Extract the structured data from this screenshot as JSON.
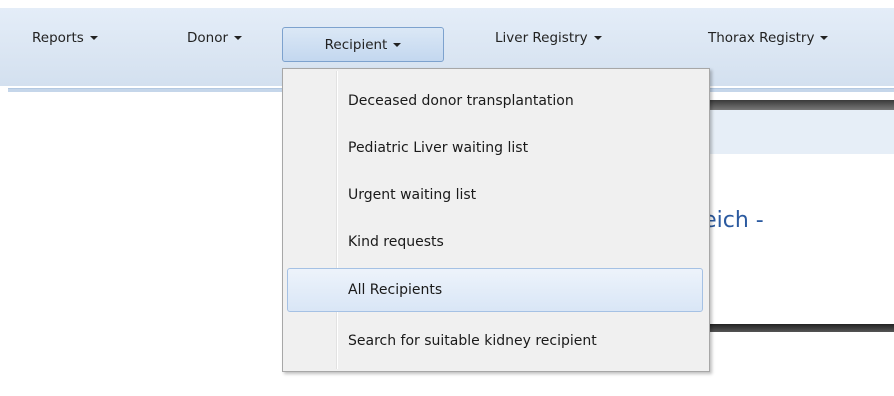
{
  "navbar": {
    "items": [
      {
        "label": "Reports"
      },
      {
        "label": "Donor"
      },
      {
        "label": "Recipient"
      },
      {
        "label": "Liver Registry"
      },
      {
        "label": "Thorax Registry"
      }
    ],
    "active_item": "Recipient"
  },
  "recipient_menu": {
    "items": [
      {
        "label": "Deceased donor transplantation"
      },
      {
        "label": "Pediatric Liver waiting list"
      },
      {
        "label": "Urgent waiting list"
      },
      {
        "label": "Kind requests"
      },
      {
        "label": "All Recipients"
      },
      {
        "label": "Search for suitable kidney recipient"
      }
    ],
    "highlighted_item": "All Recipients"
  },
  "background": {
    "heading_fragment": "s Weinreich -"
  },
  "colors": {
    "nav_gradient_top": "#e4edf8",
    "nav_gradient_bottom": "#d3e0ef",
    "menu_bg": "#f0f0f0",
    "highlight_border": "#a5c1e4",
    "heading_text": "#2b5aa0"
  },
  "icons": {
    "caret": "caret-down-icon"
  }
}
